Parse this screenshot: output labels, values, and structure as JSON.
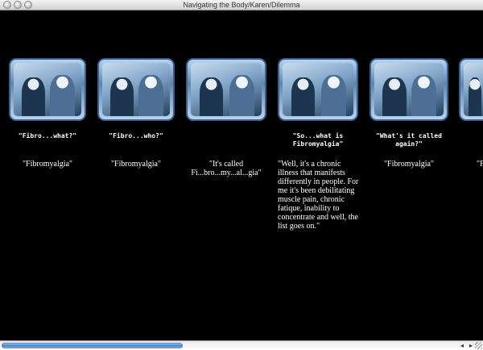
{
  "window": {
    "title": "Navigating the Body/Karen/Dilemma"
  },
  "clips": [
    {
      "cue": "\"Fibro...what?\"",
      "line": "\"Fibromyalgia\""
    },
    {
      "cue": "\"Fibro...who?\"",
      "line": "\"Fibromyalgia\""
    },
    {
      "cue": "",
      "line": "\"It's called Fi...bro...my...al...gia\""
    },
    {
      "cue": "\"So...what is Fibromyalgia\"",
      "line": "\"Well, it's a chronic illness that manifests differently in people. For me it's been debilitating muscle pain, chronic fatique, inability to concentrate and well, the list goes on.\""
    },
    {
      "cue": "\"What's it called again?\"",
      "line": "\"Fibromyalgia\""
    },
    {
      "cue": "",
      "line": "\"F"
    }
  ],
  "scrollbar": {
    "position": 0.0,
    "left_arrow": "◂",
    "right_arrow": "▸"
  }
}
